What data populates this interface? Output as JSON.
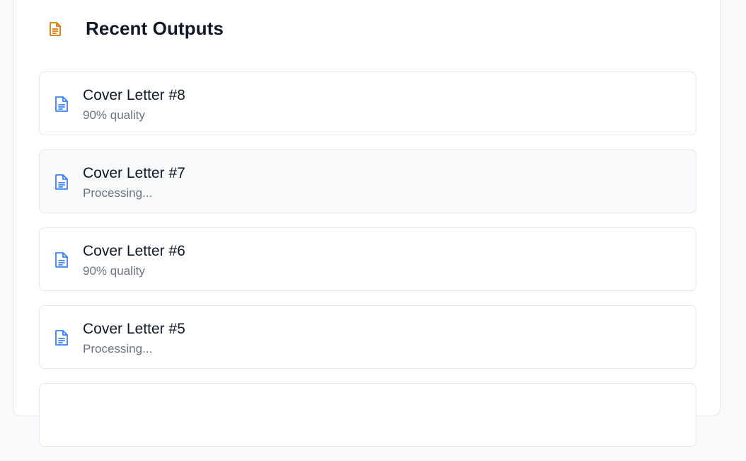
{
  "header": {
    "title": "Recent Outputs",
    "icon": "document-icon",
    "icon_color": "#d97706"
  },
  "outputs": [
    {
      "title": "Cover Letter #8",
      "status": "90% quality"
    },
    {
      "title": "Cover Letter #7",
      "status": "Processing..."
    },
    {
      "title": "Cover Letter #6",
      "status": "90% quality"
    },
    {
      "title": "Cover Letter #5",
      "status": "Processing..."
    }
  ],
  "colors": {
    "item_icon": "#3b82f6",
    "title_text": "#111827",
    "muted_text": "#6b7280"
  }
}
